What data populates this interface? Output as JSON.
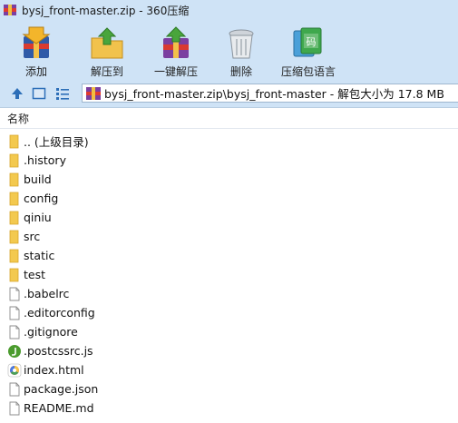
{
  "window": {
    "title": "bysj_front-master.zip - 360压缩"
  },
  "toolbar": {
    "add_label": "添加",
    "extract_to_label": "解压到",
    "one_click_extract_label": "一键解压",
    "delete_label": "删除",
    "language_label": "压缩包语言",
    "language_badge": "码"
  },
  "navbar": {
    "path": "bysj_front-master.zip\\bysj_front-master - 解包大小为 17.8 MB"
  },
  "filelist": {
    "column_name": "名称",
    "items": [
      {
        "name": ".. (上级目录)",
        "type": "folder"
      },
      {
        "name": ".history",
        "type": "folder"
      },
      {
        "name": "build",
        "type": "folder"
      },
      {
        "name": "config",
        "type": "folder"
      },
      {
        "name": "qiniu",
        "type": "folder"
      },
      {
        "name": "src",
        "type": "folder"
      },
      {
        "name": "static",
        "type": "folder"
      },
      {
        "name": "test",
        "type": "folder"
      },
      {
        "name": ".babelrc",
        "type": "file"
      },
      {
        "name": ".editorconfig",
        "type": "file"
      },
      {
        "name": ".gitignore",
        "type": "file"
      },
      {
        "name": ".postcssrc.js",
        "type": "js"
      },
      {
        "name": "index.html",
        "type": "html"
      },
      {
        "name": "package.json",
        "type": "file"
      },
      {
        "name": "README.md",
        "type": "file"
      }
    ]
  },
  "colors": {
    "chrome": "#cfe3f6",
    "folder": "#f3c94f",
    "accent": "#2d6fb8"
  }
}
